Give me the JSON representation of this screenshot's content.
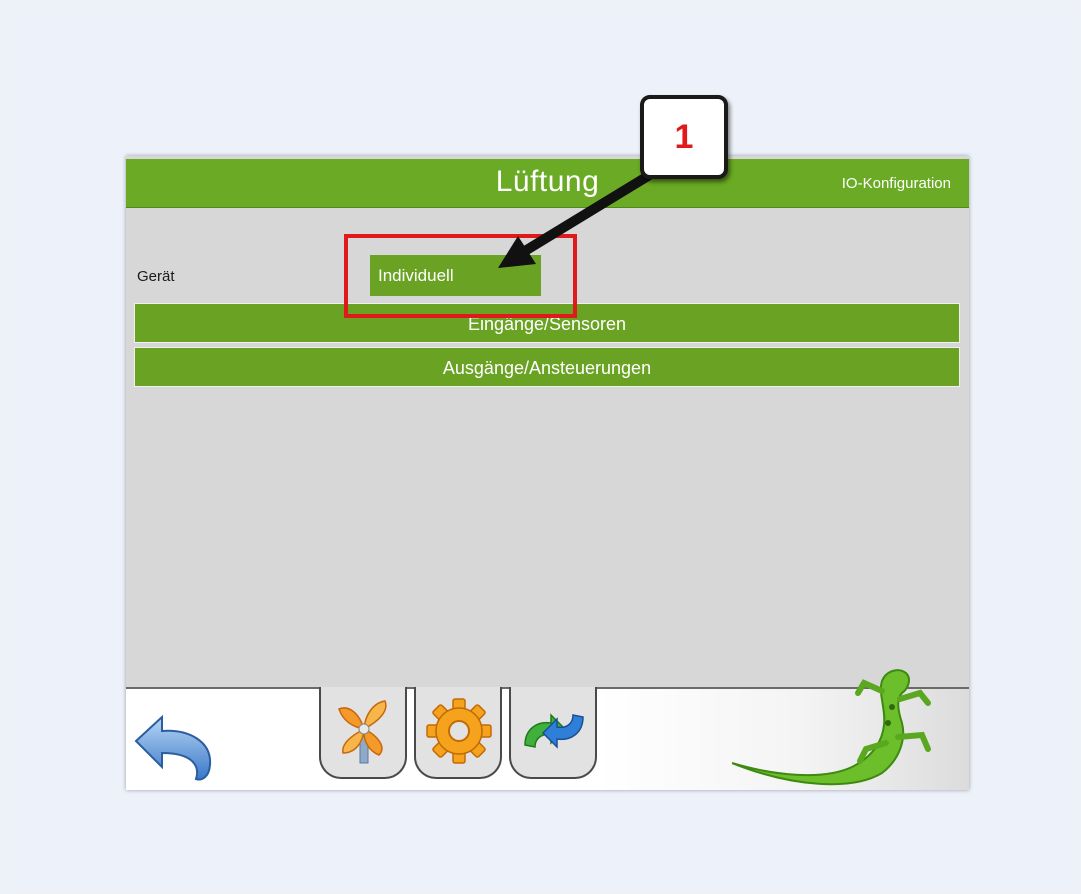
{
  "header": {
    "title": "Lüftung",
    "config_link": "IO-Konfiguration"
  },
  "device": {
    "label": "Gerät",
    "value": "Individuell"
  },
  "sections": {
    "inputs": "Eingänge/Sensoren",
    "outputs": "Ausgänge/Ansteuerungen"
  },
  "annotation": {
    "number": "1",
    "color": "#e01a1a"
  },
  "footer": {
    "icons": [
      "back-arrow-icon",
      "fan-icon",
      "gear-icon",
      "sync-arrows-icon",
      "gecko-logo"
    ]
  },
  "colors": {
    "accent": "#6aa323",
    "panel": "#d7d7d7"
  }
}
